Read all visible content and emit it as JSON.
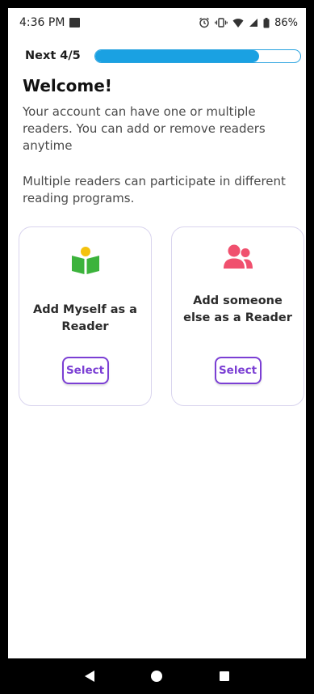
{
  "status_bar": {
    "time": "4:36 PM",
    "battery": "86%",
    "icons": [
      "image-icon",
      "alarm-icon",
      "vibrate-icon",
      "wifi-icon",
      "signal-icon",
      "battery-icon"
    ]
  },
  "progress": {
    "label": "Next 4/5",
    "fraction": 0.8,
    "color": "#1aa1e2"
  },
  "welcome": {
    "title": "Welcome!",
    "paragraph1": "Your account can have one or multiple readers. You can add or remove readers anytime",
    "paragraph2": "Multiple readers can participate in different reading programs."
  },
  "cards": [
    {
      "icon": "reader-book-icon",
      "text": "Add Myself as a Reader",
      "button": "Select"
    },
    {
      "icon": "users-icon",
      "text": "Add someone else as a Reader",
      "button": "Select"
    }
  ],
  "colors": {
    "accent": "#7b3fd4",
    "progress": "#1aa1e2",
    "book_green": "#3cb33c",
    "head_yellow": "#f4c20d",
    "users_red": "#f0506e"
  },
  "nav_bar": {
    "icons": [
      "back-icon",
      "home-icon",
      "recents-icon"
    ]
  }
}
